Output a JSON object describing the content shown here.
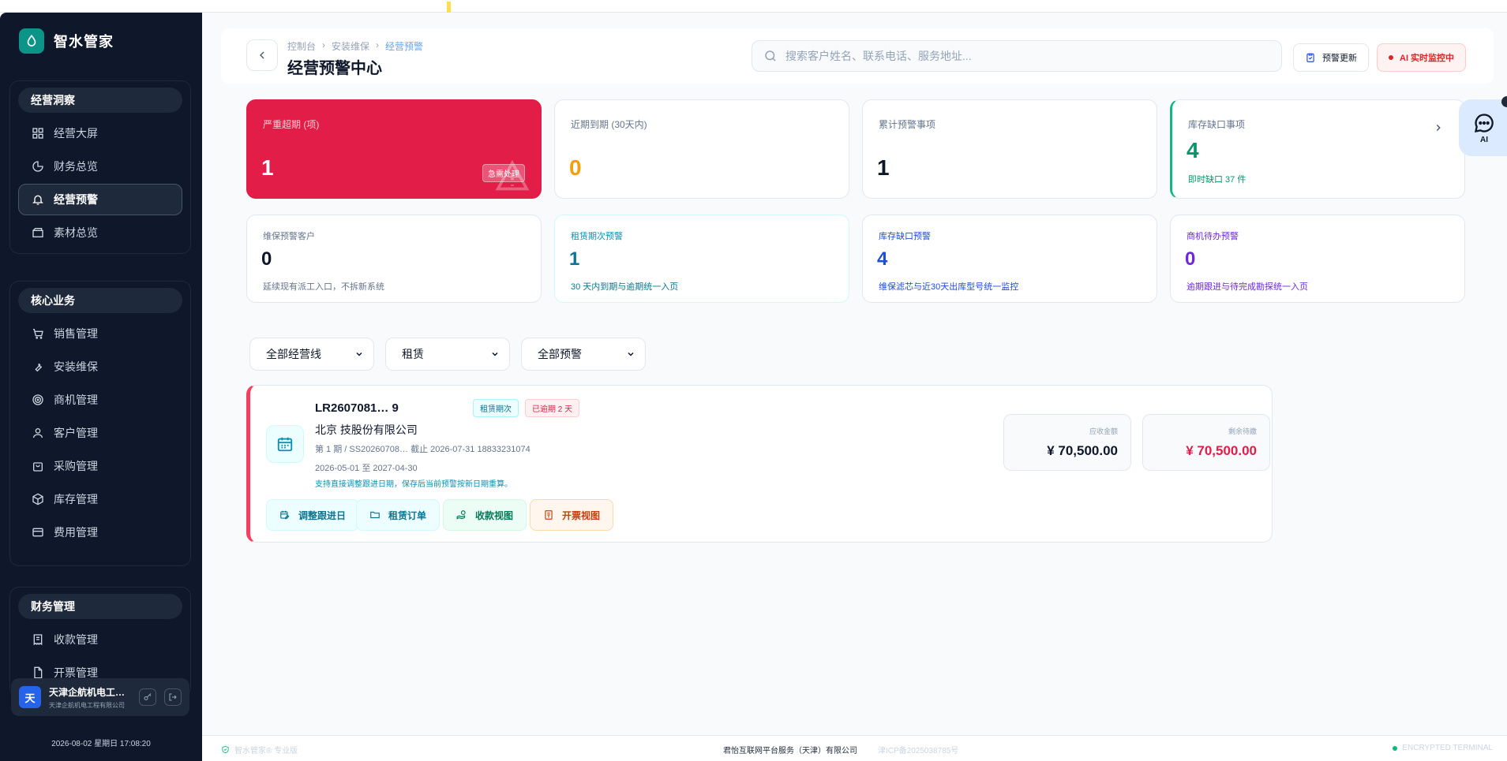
{
  "brand": {
    "name": "智水管家"
  },
  "sidebar": {
    "groups": [
      {
        "title": "经营洞察",
        "items": [
          {
            "label": "经营大屏",
            "icon": "grid-icon"
          },
          {
            "label": "财务总览",
            "icon": "pie-chart-icon"
          },
          {
            "label": "经营预警",
            "icon": "alarm-icon",
            "active": true
          },
          {
            "label": "素材总览",
            "icon": "clapper-icon"
          }
        ]
      },
      {
        "title": "核心业务",
        "items": [
          {
            "label": "销售管理",
            "icon": "cart-icon"
          },
          {
            "label": "安装维保",
            "icon": "wrench-icon"
          },
          {
            "label": "商机管理",
            "icon": "target-icon"
          },
          {
            "label": "客户管理",
            "icon": "user-icon"
          },
          {
            "label": "采购管理",
            "icon": "bag-icon"
          },
          {
            "label": "库存管理",
            "icon": "box-icon"
          },
          {
            "label": "费用管理",
            "icon": "wallet-icon"
          }
        ]
      },
      {
        "title": "财务管理",
        "items": [
          {
            "label": "收款管理",
            "icon": "receipt-icon"
          },
          {
            "label": "开票管理",
            "icon": "file-icon"
          }
        ]
      }
    ],
    "user": {
      "avatar": "天",
      "name": "天津企航机电工程...",
      "sub": "天津企航机电工程有限公司"
    },
    "datetime": "2026-08-02 星期日 17:08:20"
  },
  "header": {
    "breadcrumb": [
      "控制台",
      "安装维保",
      "经营预警"
    ],
    "title": "经营预警中心",
    "search_placeholder": "搜索客户姓名、联系电话、服务地址...",
    "update_label": "预警更新",
    "ai_label": "AI 实时监控中"
  },
  "summary": [
    {
      "label": "严重超期 (项)",
      "value": "1",
      "tag": "急需处理"
    },
    {
      "label": "近期到期 (30天内)",
      "value": "0"
    },
    {
      "label": "累计预警事项",
      "value": "1"
    },
    {
      "label": "库存缺口事项",
      "value": "4",
      "sub": "即时缺口 37 件"
    }
  ],
  "details": [
    {
      "label": "维保预警客户",
      "value": "0",
      "sub": "延续现有派工入口，不拆新系统"
    },
    {
      "label": "租赁期次预警",
      "value": "1",
      "sub": "30 天内到期与逾期统一入页"
    },
    {
      "label": "库存缺口预警",
      "value": "4",
      "sub": "维保滤芯与近30天出库型号统一监控"
    },
    {
      "label": "商机待办预警",
      "value": "0",
      "sub": "逾期跟进与待完成勘探统一入页"
    }
  ],
  "filters": [
    "全部经营线",
    "租赁",
    "全部预警"
  ],
  "alert_item": {
    "code": "LR2607081…         9",
    "tag_type": "租赁期次",
    "tag_overdue": "已逾期 2 天",
    "company": "北京                    技股份有限公司",
    "meta1": "第 1 期 / SS20260708…    截止 2026-07-31   18833231074",
    "meta2": "2026-05-01 至 2027-04-30",
    "tip": "支持直接调整跟进日期，保存后当前预警按新日期重算。",
    "actions": [
      "调整跟进日",
      "租赁订单",
      "收款视图",
      "开票视图"
    ],
    "receivable_label": "应收金额",
    "receivable": "¥ 70,500.00",
    "remaining_label": "剩余待繳",
    "remaining": "¥ 70,500.00"
  },
  "ai_float": {
    "label": "AI"
  },
  "footer": {
    "left": "智水管家® 专业版",
    "company": "君怡互联网平台服务（天津）有限公司",
    "icp": "津ICP备2025038785号",
    "right": "ENCRYPTED TERMINAL"
  },
  "colors": {
    "accent": "#e11d48",
    "sidebar_bg": "#0f172a",
    "brand": "#0d9488"
  }
}
